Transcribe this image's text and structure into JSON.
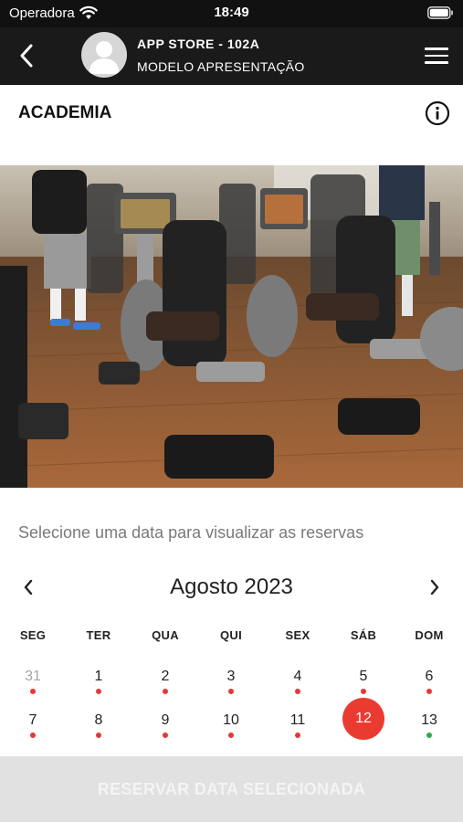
{
  "status_bar": {
    "carrier": "Operadora",
    "time": "18:49",
    "wifi_icon": "wifi-icon",
    "battery_icon": "battery-icon"
  },
  "header": {
    "title": "APP STORE - 102A",
    "subtitle": "MODELO APRESENTAÇÃO",
    "back_icon": "chevron-left-icon",
    "menu_icon": "hamburger-menu-icon",
    "avatar_icon": "user-avatar-icon",
    "background": "#1a1a1a"
  },
  "section": {
    "title": "ACADEMIA",
    "info_icon": "info-icon"
  },
  "photo": {
    "subject": "gym-exercise-bikes-photo"
  },
  "calendar": {
    "instruction": "Selecione uma data para visualizar as reservas",
    "month_label": "Agosto 2023",
    "prev_icon": "chevron-left-icon",
    "next_icon": "chevron-right-icon",
    "weekdays": [
      "SEG",
      "TER",
      "QUA",
      "QUI",
      "SEX",
      "SÁB",
      "DOM"
    ],
    "weeks": [
      [
        {
          "day": "31",
          "muted": true,
          "dot": "red"
        },
        {
          "day": "1",
          "muted": false,
          "dot": "red"
        },
        {
          "day": "2",
          "muted": false,
          "dot": "red"
        },
        {
          "day": "3",
          "muted": false,
          "dot": "red"
        },
        {
          "day": "4",
          "muted": false,
          "dot": "red"
        },
        {
          "day": "5",
          "muted": false,
          "dot": "red"
        },
        {
          "day": "6",
          "muted": false,
          "dot": "red"
        }
      ],
      [
        {
          "day": "7",
          "muted": false,
          "dot": "red"
        },
        {
          "day": "8",
          "muted": false,
          "dot": "red"
        },
        {
          "day": "9",
          "muted": false,
          "dot": "red"
        },
        {
          "day": "10",
          "muted": false,
          "dot": "red"
        },
        {
          "day": "11",
          "muted": false,
          "dot": "red"
        },
        {
          "day": "12",
          "muted": false,
          "dot": "none",
          "selected": true
        },
        {
          "day": "13",
          "muted": false,
          "dot": "green"
        }
      ]
    ],
    "colors": {
      "dot_red": "#e53935",
      "dot_green": "#2ea84a",
      "selected": "#ea3b30"
    }
  },
  "reserve_button": {
    "label": "RESERVAR DATA SELECIONADA",
    "enabled": false
  }
}
